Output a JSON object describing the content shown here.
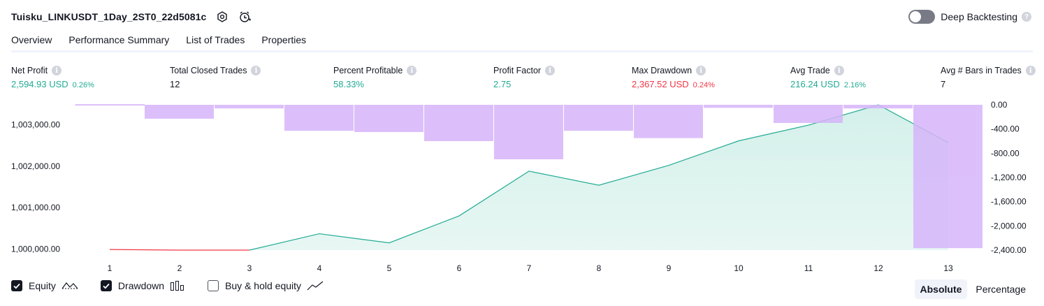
{
  "header": {
    "title": "Tuisku_LINKUSDT_1Day_2ST0_22d5081c",
    "deep_backtesting_label": "Deep Backtesting",
    "deep_backtesting_enabled": false
  },
  "tabs": [
    {
      "label": "Overview",
      "active": true
    },
    {
      "label": "Performance Summary",
      "active": false
    },
    {
      "label": "List of Trades",
      "active": false
    },
    {
      "label": "Properties",
      "active": false
    }
  ],
  "metrics": [
    {
      "label": "Net Profit",
      "value": "2,594.93 USD",
      "pct": "0.26%",
      "color": "#22ab94"
    },
    {
      "label": "Total Closed Trades",
      "value": "12",
      "pct": "",
      "color": "#131722"
    },
    {
      "label": "Percent Profitable",
      "value": "58.33%",
      "pct": "",
      "color": "#22ab94"
    },
    {
      "label": "Profit Factor",
      "value": "2.75",
      "pct": "",
      "color": "#22ab94"
    },
    {
      "label": "Max Drawdown",
      "value": "2,367.52 USD",
      "pct": "0.24%",
      "color": "#f23645"
    },
    {
      "label": "Avg Trade",
      "value": "216.24 USD",
      "pct": "2.16%",
      "color": "#22ab94"
    },
    {
      "label": "Avg # Bars in Trades",
      "value": "7",
      "pct": "",
      "color": "#131722"
    }
  ],
  "chart_data": {
    "type": "line",
    "x": [
      1,
      2,
      3,
      4,
      5,
      6,
      7,
      8,
      9,
      10,
      11,
      12,
      13
    ],
    "x_ticks": [
      "1",
      "2",
      "3",
      "4",
      "5",
      "6",
      "7",
      "8",
      "9",
      "10",
      "11",
      "12",
      "13"
    ],
    "series": [
      {
        "name": "Equity",
        "values": [
          999990,
          999975,
          999975,
          1000370,
          1000150,
          1000800,
          1001880,
          1001540,
          1002020,
          1002610,
          1002990,
          1003480,
          1002570
        ]
      },
      {
        "name": "Drawdown",
        "type": "bar",
        "values": [
          -10,
          -230,
          -60,
          -430,
          -450,
          -600,
          -900,
          -430,
          -550,
          -50,
          -300,
          -60,
          -2367.52
        ]
      }
    ],
    "left_axis": {
      "ticks": [
        "1,000,000.00",
        "1,001,000.00",
        "1,002,000.00",
        "1,003,000.00"
      ],
      "tick_values": [
        1000000,
        1001000,
        1002000,
        1003000
      ],
      "range": [
        999975,
        1003480
      ]
    },
    "right_axis": {
      "ticks": [
        "0.00",
        "-400.00",
        "-800.00",
        "-1,200.00",
        "-1,600.00",
        "-2,000.00",
        "-2,400.00"
      ],
      "tick_values": [
        0,
        -400,
        -800,
        -1200,
        -1600,
        -2000,
        -2400
      ],
      "range": [
        0,
        -2400
      ]
    },
    "colors": {
      "equity_up": "#22ab94",
      "equity_down": "#f23645",
      "equity_fill": "#d4f0ea",
      "drawdown": "#d6b5fa"
    }
  },
  "footer": {
    "legend": [
      {
        "label": "Equity",
        "checked": true,
        "icon": "equity-line-icon"
      },
      {
        "label": "Drawdown",
        "checked": true,
        "icon": "drawdown-bars-icon"
      },
      {
        "label": "Buy & hold equity",
        "checked": false,
        "icon": "buy-hold-line-icon"
      }
    ],
    "modes": [
      {
        "label": "Absolute",
        "active": true
      },
      {
        "label": "Percentage",
        "active": false
      }
    ]
  }
}
